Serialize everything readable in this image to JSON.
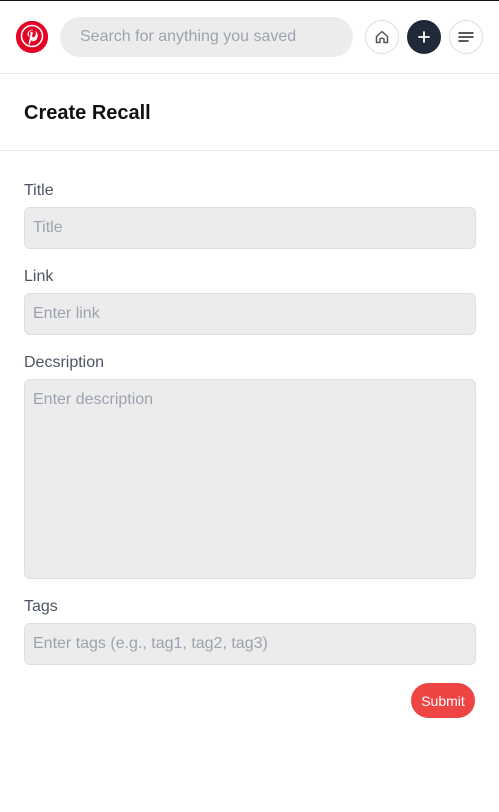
{
  "navbar": {
    "logo_icon": "pinterest-logo-icon",
    "search_placeholder": "Search for anything you saved",
    "home_icon": "home-icon",
    "add_icon": "plus-icon",
    "menu_icon": "hamburger-menu-icon",
    "brand_color": "#e60023"
  },
  "page": {
    "title": "Create Recall"
  },
  "form": {
    "title_label": "Title",
    "title_placeholder": "Title",
    "link_label": "Link",
    "link_placeholder": "Enter link",
    "description_label": "Decsription",
    "description_placeholder": "Enter description",
    "tags_label": "Tags",
    "tags_placeholder": "Enter tags (e.g., tag1, tag2, tag3)",
    "submit_label": "Submit",
    "submit_color": "#ef4444"
  }
}
